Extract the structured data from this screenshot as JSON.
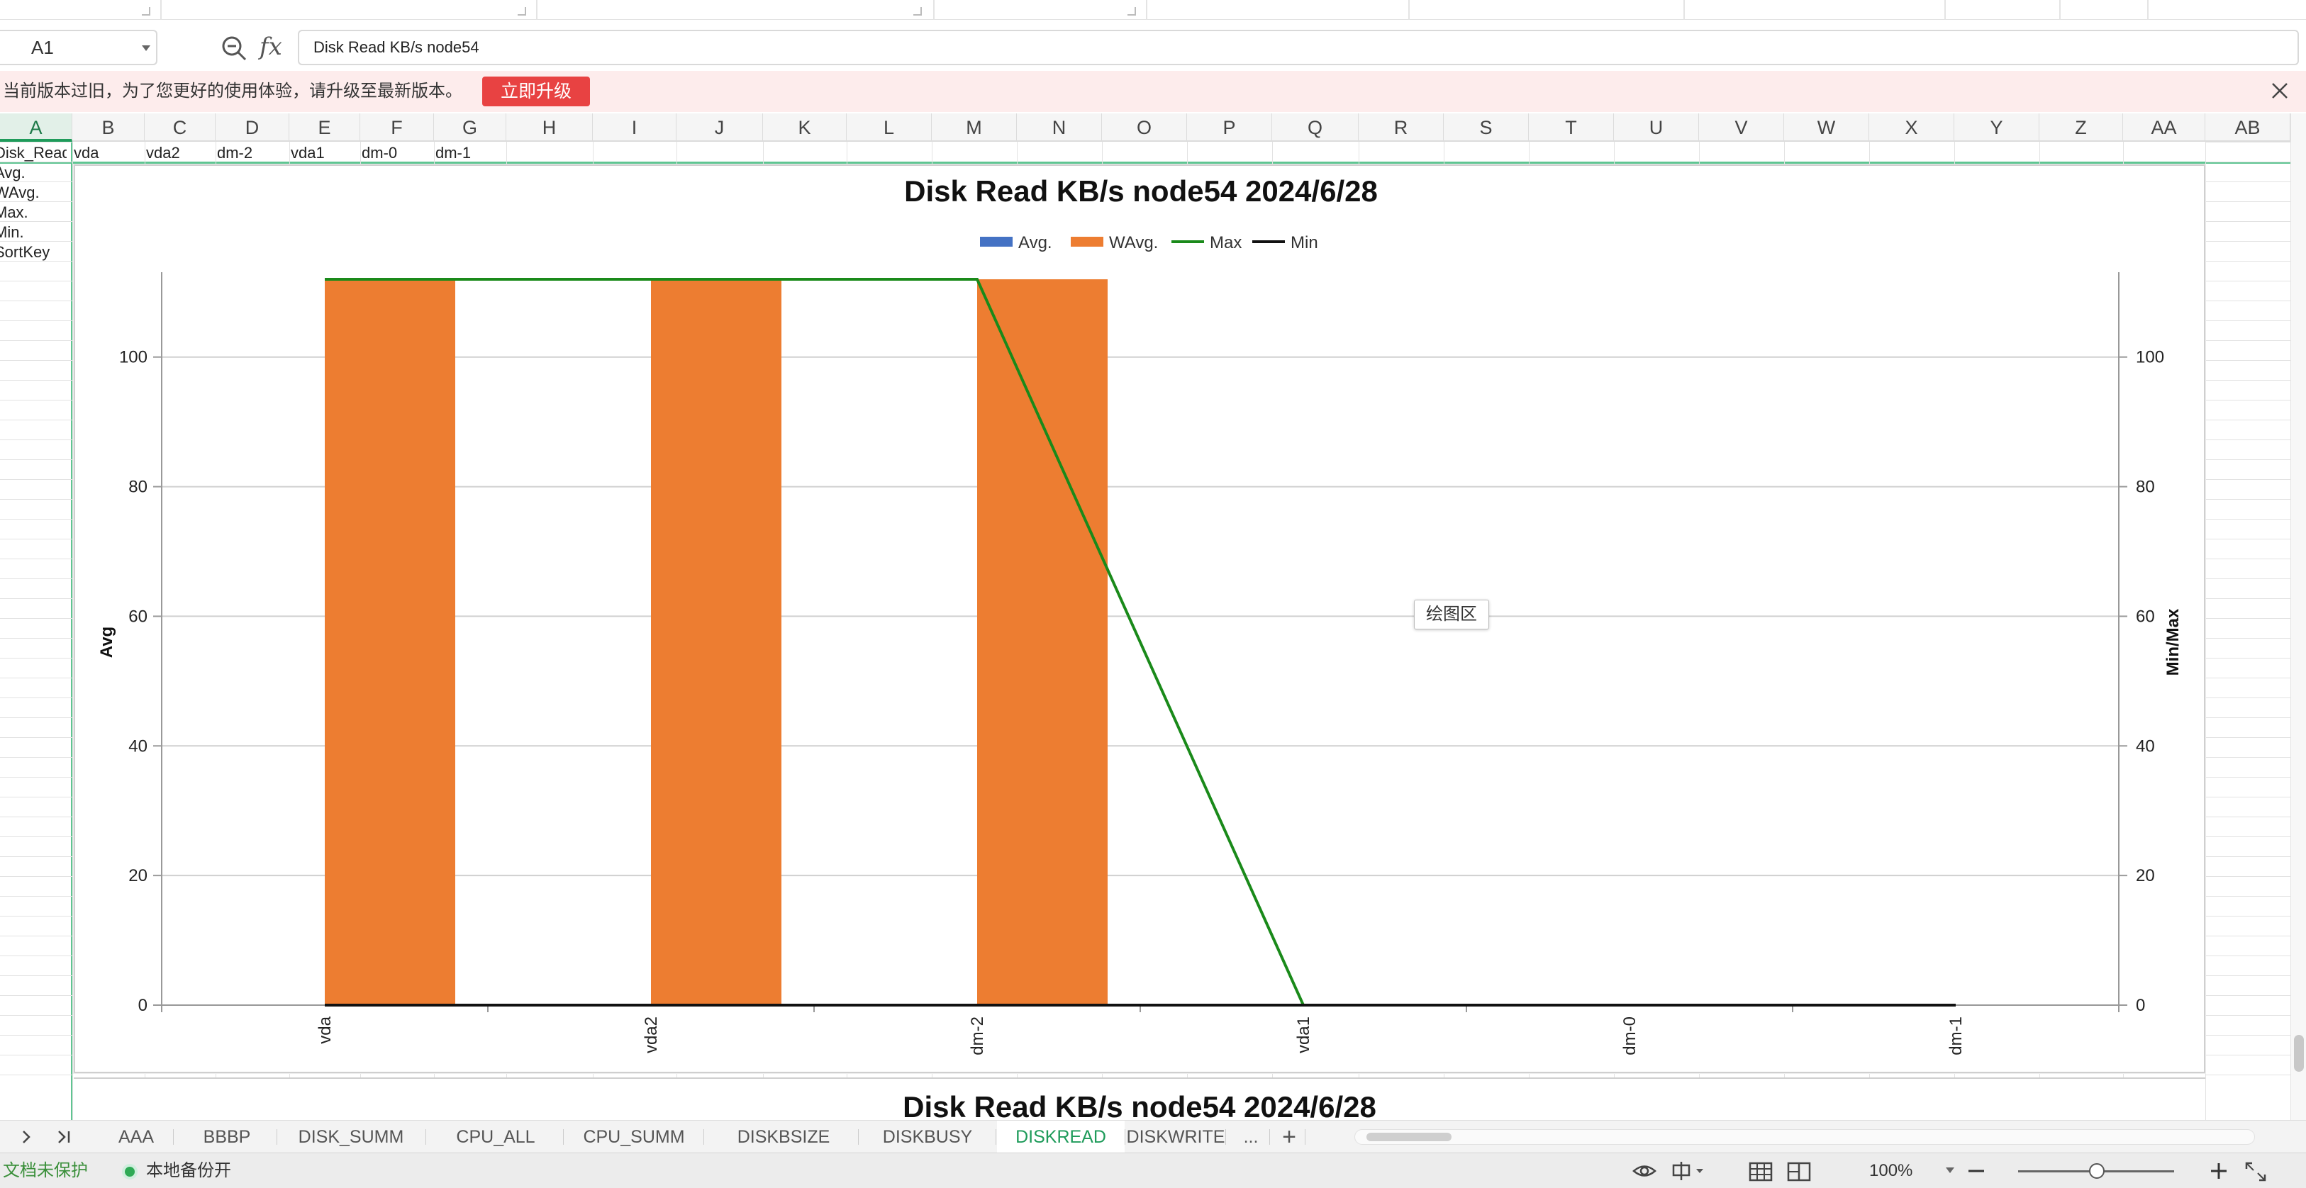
{
  "formula_bar": {
    "cell_ref": "A1",
    "formula": "Disk Read KB/s node54"
  },
  "notice": {
    "text": "当前版本过旧，为了您更好的使用体验，请升级至最新版本。",
    "button": "立即升级"
  },
  "columns": [
    "A",
    "B",
    "C",
    "D",
    "E",
    "F",
    "G",
    "H",
    "I",
    "J",
    "K",
    "L",
    "M",
    "N",
    "O",
    "P",
    "Q",
    "R",
    "S",
    "T",
    "U",
    "V",
    "W",
    "X",
    "Y",
    "Z",
    "AA",
    "AB"
  ],
  "row1": [
    "Disk_Read",
    "vda",
    "vda2",
    "dm-2",
    "vda1",
    "dm-0",
    "dm-1"
  ],
  "colA": [
    "Avg.",
    "WAvg.",
    "Max.",
    "Min.",
    "SortKey"
  ],
  "chart_data": {
    "type": "bar",
    "title": "Disk Read KB/s node54  2024/6/28",
    "categories": [
      "vda",
      "vda2",
      "dm-2",
      "vda1",
      "dm-0",
      "dm-1"
    ],
    "series": [
      {
        "name": "Avg.",
        "type": "bar",
        "axis": "left",
        "color": "#4472c4",
        "values": [
          0,
          0,
          0,
          0,
          0,
          0
        ]
      },
      {
        "name": "WAvg.",
        "type": "bar",
        "axis": "left",
        "color": "#ed7d31",
        "values": [
          112,
          112,
          112,
          0,
          0,
          0
        ]
      },
      {
        "name": "Max",
        "type": "line",
        "axis": "right",
        "color": "#1a8a1a",
        "values": [
          112,
          112,
          112,
          0,
          0,
          0
        ]
      },
      {
        "name": "Min",
        "type": "line",
        "axis": "right",
        "color": "#111111",
        "values": [
          0,
          0,
          0,
          0,
          0,
          0
        ]
      }
    ],
    "ylabel": "Avg",
    "y2label": "Min/Max",
    "ylim": [
      0,
      112
    ],
    "yticks": [
      0,
      20,
      40,
      60,
      80,
      100
    ],
    "grid": true,
    "legend": "top"
  },
  "plot_tip": "绘图区",
  "tabs": [
    "AAA",
    "BBBP",
    "DISK_SUMM",
    "CPU_ALL",
    "CPU_SUMM",
    "DISKBSIZE",
    "DISKBUSY",
    "DISKREAD",
    "DISKWRITE",
    "...",
    "+"
  ],
  "active_tab": "DISKREAD",
  "status": {
    "protect": "文档未保护",
    "backup": "本地备份开",
    "zoom": "100%"
  }
}
